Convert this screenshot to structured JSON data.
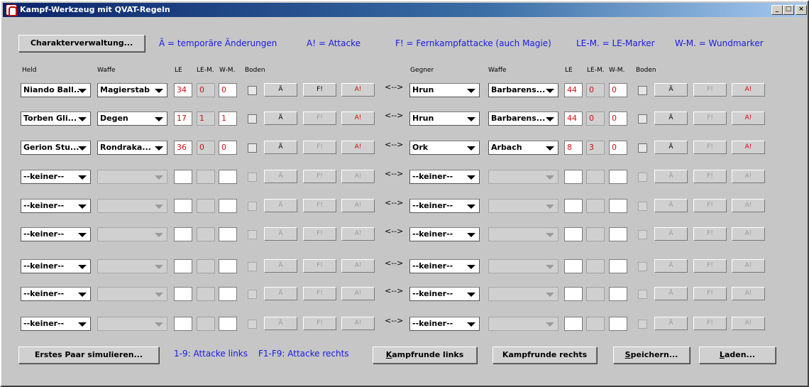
{
  "window": {
    "title": "Kampf-Werkzeug mit QVAT-Regeln",
    "controls": [
      "_",
      "□",
      "×"
    ]
  },
  "top": {
    "char_button": "Charakterverwaltung...",
    "legend": [
      "Ä = temporäre Änderungen",
      "A! = Attacke",
      "F! = Fernkampfattacke (auch Magie)",
      "LE-M. = LE-Marker",
      "W-M. = Wundmarker"
    ]
  },
  "headers": {
    "held": "Held",
    "waffe": "Waffe",
    "le": "LE",
    "lem": "LE-M.",
    "wm": "W-M.",
    "boden": "Boden",
    "gegner": "Gegner",
    "waffe2": "Waffe",
    "le2": "LE",
    "lem2": "LE-M.",
    "wm2": "W-M.",
    "boden2": "Boden"
  },
  "labels": {
    "change": "Ä",
    "ranged": "F!",
    "attack": "A!",
    "vs": "<-->"
  },
  "colors": {
    "legend_text": "#1a1ae6",
    "value_text": "#d01010",
    "title_bar": "#0a246a"
  },
  "rows": [
    {
      "active": true,
      "hero": "Niando Ball...",
      "weapon": "Magierstab",
      "le": "34",
      "lem": "0",
      "wm": "0",
      "f_enabled": true,
      "enemy": "Hrun",
      "enemy_weapon": "Barbarens...",
      "ele": "44",
      "elem": "0",
      "ewm": "0"
    },
    {
      "active": true,
      "hero": "Torben Gli...",
      "weapon": "Degen",
      "le": "17",
      "lem": "1",
      "wm": "1",
      "f_enabled": false,
      "enemy": "Hrun",
      "enemy_weapon": "Barbarens...",
      "ele": "44",
      "elem": "0",
      "ewm": "0"
    },
    {
      "active": true,
      "hero": "Gerion Stu...",
      "weapon": "Rondraka...",
      "le": "36",
      "lem": "0",
      "wm": "0",
      "f_enabled": false,
      "enemy": "Ork",
      "enemy_weapon": "Arbach",
      "ele": "8",
      "elem": "3",
      "ewm": "0"
    },
    {
      "active": false,
      "hero": "--keiner--",
      "weapon": "",
      "le": "",
      "lem": "",
      "wm": "",
      "f_enabled": false,
      "enemy": "--keiner--",
      "enemy_weapon": "",
      "ele": "",
      "elem": "",
      "ewm": ""
    },
    {
      "active": false,
      "hero": "--keiner--",
      "weapon": "",
      "le": "",
      "lem": "",
      "wm": "",
      "f_enabled": false,
      "enemy": "--keiner--",
      "enemy_weapon": "",
      "ele": "",
      "elem": "",
      "ewm": ""
    },
    {
      "active": false,
      "hero": "--keiner--",
      "weapon": "",
      "le": "",
      "lem": "",
      "wm": "",
      "f_enabled": false,
      "enemy": "--keiner--",
      "enemy_weapon": "",
      "ele": "",
      "elem": "",
      "ewm": ""
    },
    {
      "active": false,
      "hero": "--keiner--",
      "weapon": "",
      "le": "",
      "lem": "",
      "wm": "",
      "f_enabled": false,
      "enemy": "--keiner--",
      "enemy_weapon": "",
      "ele": "",
      "elem": "",
      "ewm": ""
    },
    {
      "active": false,
      "hero": "--keiner--",
      "weapon": "",
      "le": "",
      "lem": "",
      "wm": "",
      "f_enabled": false,
      "enemy": "--keiner--",
      "enemy_weapon": "",
      "ele": "",
      "elem": "",
      "ewm": ""
    },
    {
      "active": false,
      "hero": "--keiner--",
      "weapon": "",
      "le": "",
      "lem": "",
      "wm": "",
      "f_enabled": false,
      "enemy": "--keiner--",
      "enemy_weapon": "",
      "ele": "",
      "elem": "",
      "ewm": ""
    }
  ],
  "bottom": {
    "simulate": "Erstes Paar simulieren...",
    "hint_left": "1-9: Attacke links",
    "hint_right": "F1-F9: Attacke rechts",
    "round_left": "Kampfrunde links",
    "round_right": "Kampfrunde rechts",
    "save": "Speichern...",
    "load": "Laden..."
  }
}
